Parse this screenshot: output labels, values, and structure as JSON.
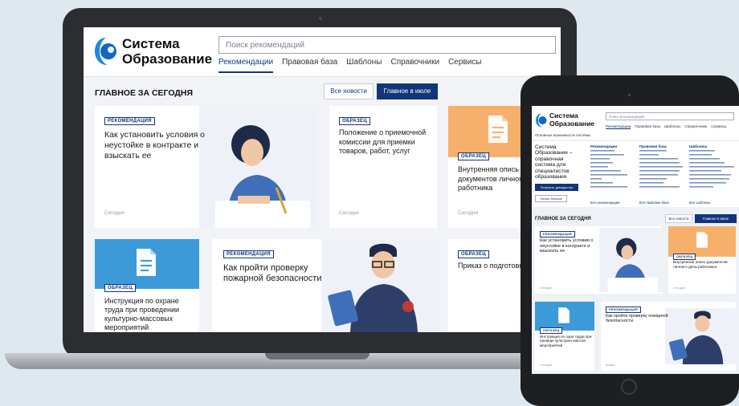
{
  "laptop": {
    "logo": {
      "line1": "Система",
      "line2": "Образование"
    },
    "search_placeholder": "Поиск рекомендаций",
    "nav": [
      "Рекомендации",
      "Правовая база",
      "Шаблоны",
      "Справочники",
      "Сервисы"
    ],
    "section_title": "ГЛАВНОЕ ЗА СЕГОДНЯ",
    "btn_all": "Все новости",
    "btn_main": "Главное в июле",
    "cards": [
      {
        "badge": "РЕКОМЕНДАЦИЯ",
        "title": "Как установить условия о неустойке в контракте и взыскать ее",
        "date": "Сегодня"
      },
      {
        "badge": "ОБРАЗЕЦ",
        "title": "Положение о приемочной комиссии для приемки товаров, работ, услуг",
        "date": "Сегодня"
      },
      {
        "badge": "ОБРАЗЕЦ",
        "title": "Внутренняя опись документов личного работника",
        "date": "Сегодня"
      },
      {
        "badge": "ОБРАЗЕЦ",
        "title": "Инструкция по охране труда при проведении культурно-массовых мероприятий"
      },
      {
        "badge": "РЕКОМЕНДАЦИЯ",
        "title": "Как пройти проверку пожарной безопасности"
      },
      {
        "badge": "ОБРАЗЕЦ",
        "title": "Приказ о подготовке детского сада к пр"
      }
    ]
  },
  "tablet": {
    "logo": {
      "line1": "Система",
      "line2": "Образование"
    },
    "search_placeholder": "Поиск рекомендаций",
    "nav": [
      "Рекомендации",
      "Правовая база",
      "Шаблоны",
      "Справочники",
      "Сервисы"
    ],
    "subnav": "Основные возможности системы",
    "hero_title": "Система Образование – справочная система для специалистов образования",
    "hero_btn": "Получить демодоступ",
    "hero_btn2": "Узнать больше",
    "col_titles": [
      "Рекомендации",
      "Правовая база",
      "Шаблоны"
    ],
    "col_footers": [
      "Все рекомендации",
      "Вся правовая база",
      "Все шаблоны"
    ],
    "section_title": "ГЛАВНОЕ ЗА СЕГОДНЯ",
    "btn_all": "Все новости",
    "btn_main": "Главное в июле",
    "cards": [
      {
        "badge": "РЕКОМЕНДАЦИЯ",
        "title": "Как установить условия о неустойке в контракте и взыскать ее",
        "date": "Сегодня"
      },
      {
        "badge": "ОБРАЗЕЦ",
        "title": "Внутренняя опись документов личного дела работника",
        "date": "Сегодня"
      },
      {
        "badge": "ОБРАЗЕЦ",
        "title": "Инструкция по охра труда при проведе культурно-массов мероприятий",
        "date": "Сегодня"
      },
      {
        "badge": "РЕКОМЕНДАЦИЯ",
        "title": "Как пройти проверку пожарной безопасности",
        "date": "Вчера"
      }
    ]
  },
  "colors": {
    "accent": "#12357a",
    "blue_card": "#3d9ad8",
    "orange_card": "#f7b06c",
    "logo_blue": "#1e88e5"
  }
}
